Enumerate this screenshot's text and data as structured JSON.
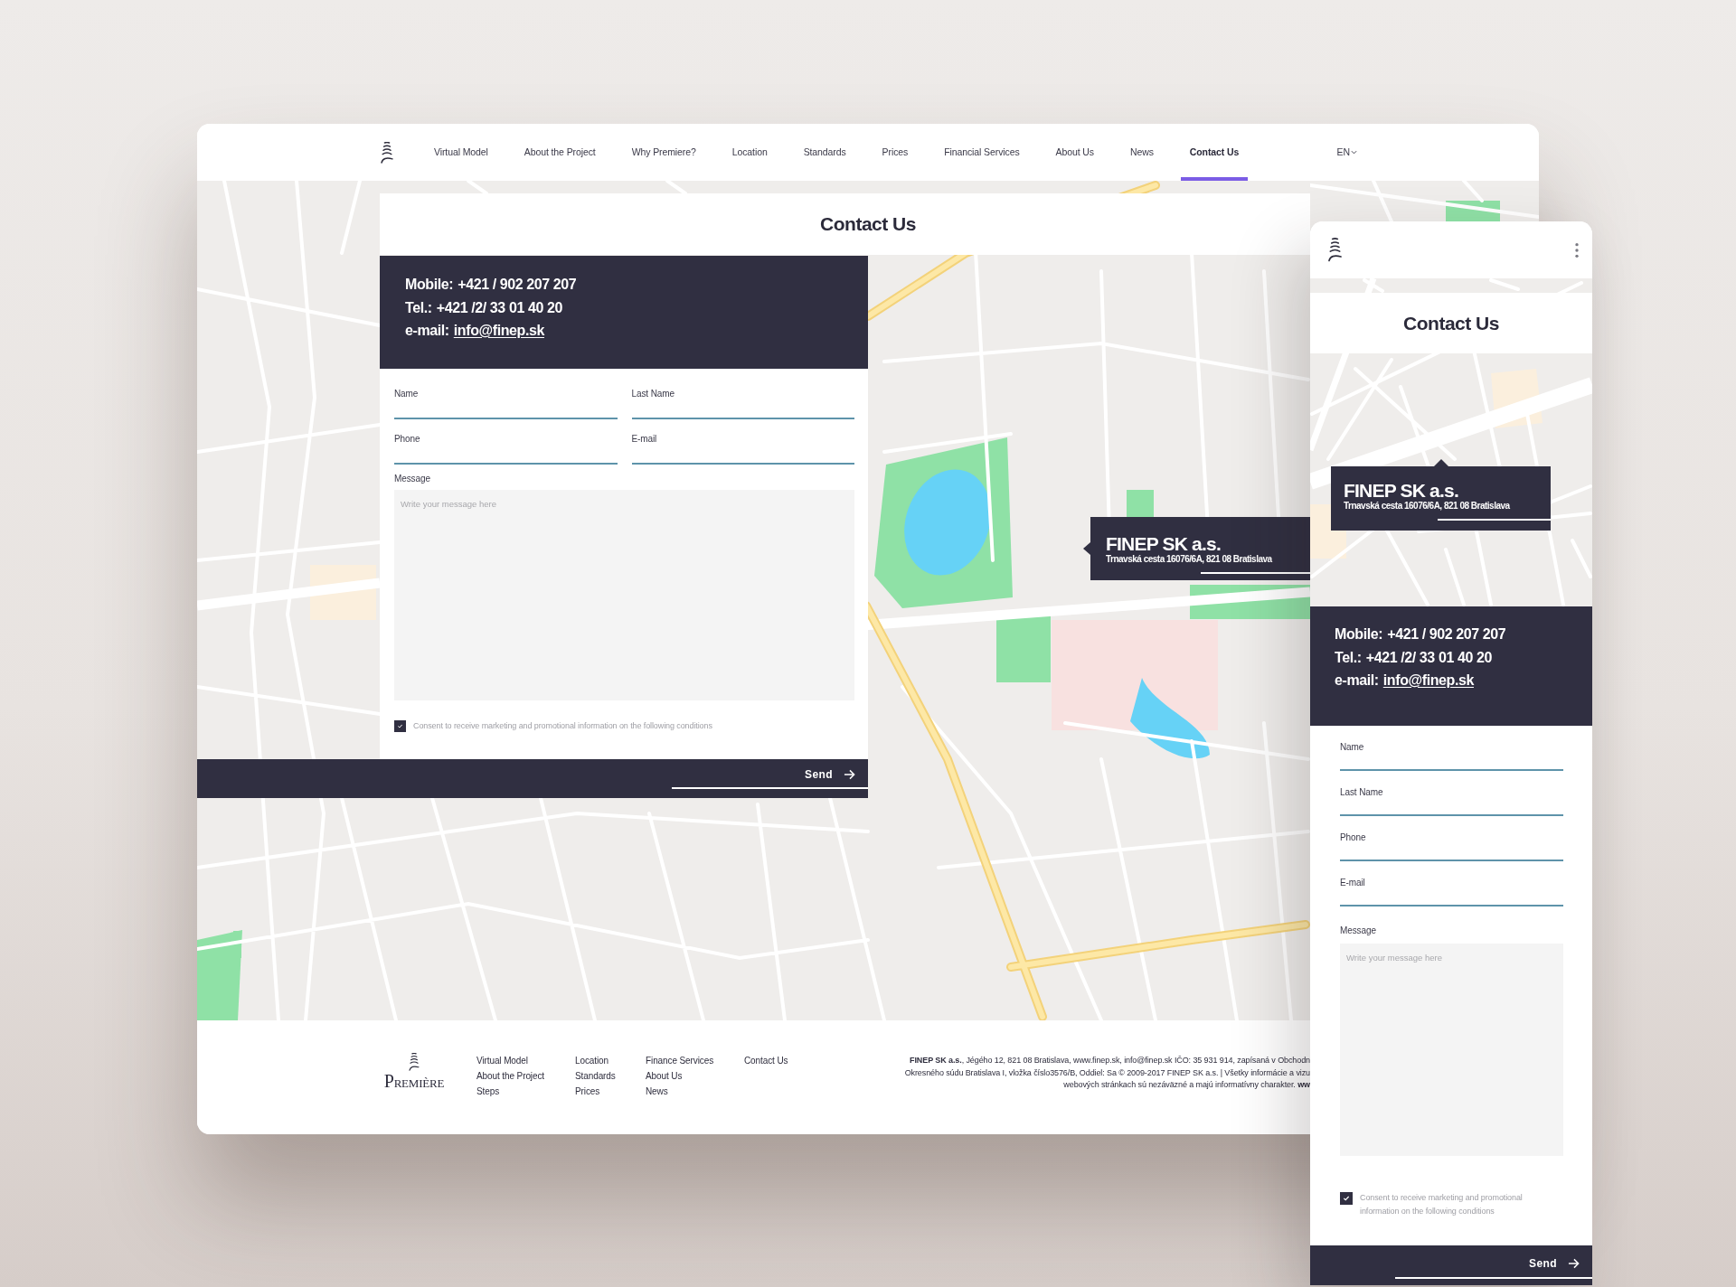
{
  "desktop": {
    "nav": {
      "items": [
        {
          "label": "Virtual Model",
          "selected": false
        },
        {
          "label": "About the Project",
          "selected": false
        },
        {
          "label": "Why Premiere?",
          "selected": false
        },
        {
          "label": "Location",
          "selected": false
        },
        {
          "label": "Standards",
          "selected": false
        },
        {
          "label": "Prices",
          "selected": false
        },
        {
          "label": "Financial Services",
          "selected": false
        },
        {
          "label": "About Us",
          "selected": false
        },
        {
          "label": "News",
          "selected": false
        },
        {
          "label": "Contact Us",
          "selected": true
        }
      ],
      "language": "EN"
    },
    "page_title": "Contact Us",
    "contact_info": [
      {
        "kind": "text",
        "label": "Mobile:",
        "value": "+421 / 902 207 207"
      },
      {
        "kind": "text",
        "label": "Tel.:",
        "value": "+421 /2/ 33 01 40 20"
      },
      {
        "kind": "link",
        "label": "e-mail:",
        "value": "info@finep.sk"
      }
    ],
    "form": {
      "fields": [
        {
          "label": "Name"
        },
        {
          "label": "Last Name"
        },
        {
          "label": "Phone"
        },
        {
          "label": "E-mail"
        }
      ],
      "message": {
        "label": "Message",
        "placeholder": "Write your message here"
      },
      "consent": {
        "text": "Consent to receive marketing and promotional information on the following conditions",
        "checked": true
      },
      "send": "Send"
    },
    "map_callout": {
      "company": "FINEP SK a.s.",
      "address": "Trnavská cesta 16076/6A, 821 08 Bratislava"
    },
    "footer": {
      "logo": "PREMIÈRE",
      "columns": [
        [
          "Virtual Model",
          "About the Project",
          "Steps"
        ],
        [
          "Location",
          "Standards",
          "Prices"
        ],
        [
          "Finance Services",
          "About Us",
          "News"
        ],
        [
          "Contact Us"
        ]
      ],
      "legal_lines": [
        "**FINEP SK a.s.**, Jégého 12, 821 08 Bratislava, www.finep.sk, info@finep.sk IČO: 35 931 914, zapísaná v Obchodn",
        "Okresného súdu Bratislava I, vložka číslo3576/B, Oddiel: Sa © 2009-2017 FINEP SK a.s. | Všetky informácie a vizu",
        "webových stránkach sú nezáväzné a majú informatívny charakter. **ww**"
      ]
    }
  },
  "mobile": {
    "page_title": "Contact Us",
    "map_callout": {
      "company": "FINEP SK a.s.",
      "address": "Trnavská cesta 16076/6A, 821 08 Bratislava"
    },
    "contact_info": [
      {
        "kind": "text",
        "label": "Mobile:",
        "value": "+421 / 902 207 207"
      },
      {
        "kind": "text",
        "label": "Tel.:",
        "value": "+421 /2/ 33 01 40 20"
      },
      {
        "kind": "link",
        "label": "e-mail:",
        "value": "info@finep.sk"
      }
    ],
    "form": {
      "fields": [
        {
          "label": "Name"
        },
        {
          "label": "Last Name"
        },
        {
          "label": "Phone"
        },
        {
          "label": "E-mail"
        }
      ],
      "message": {
        "label": "Message",
        "placeholder": "Write your message here"
      },
      "consent": {
        "text": "Consent to receive marketing and promotional information on the following conditions",
        "checked": true
      },
      "send": "Send"
    }
  }
}
